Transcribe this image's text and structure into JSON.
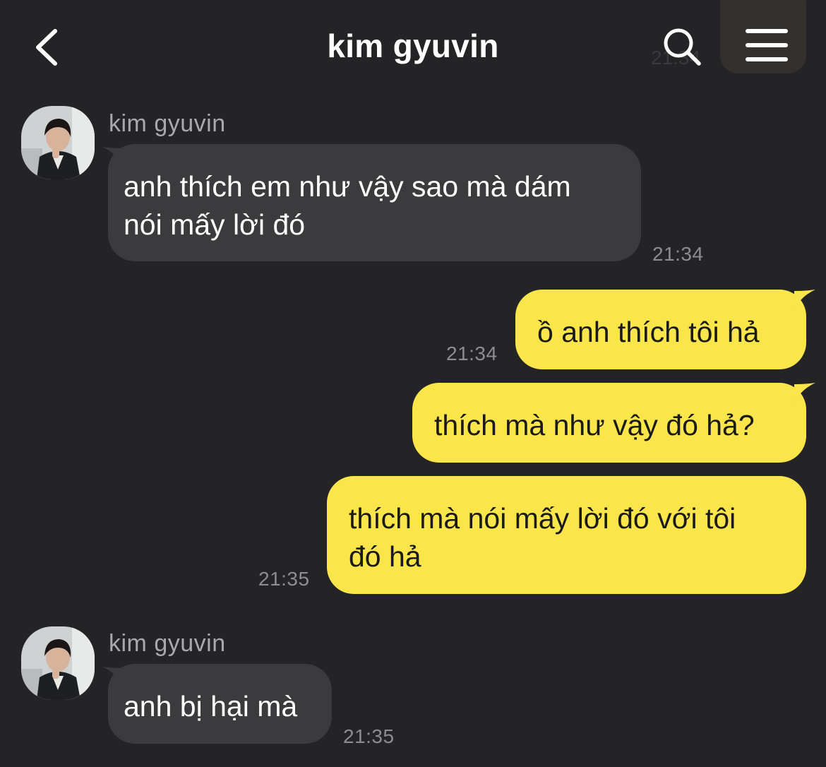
{
  "header": {
    "back_icon": "chevron-left-icon",
    "title": "kim gyuvin",
    "search_icon": "search-icon",
    "menu_icon": "hamburger-menu-icon",
    "obscured_time": "21:34"
  },
  "colors": {
    "background": "#242427",
    "incoming_bubble": "#3b3b3e",
    "outgoing_bubble": "#fae54a",
    "timestamp": "#8c8c91"
  },
  "messages": [
    {
      "direction": "incoming",
      "sender": "kim gyuvin",
      "lines": [
        "anh thích em như vậy sao mà dám",
        "nói mấy lời đó"
      ],
      "time": "21:34"
    },
    {
      "direction": "outgoing",
      "lines": [
        "ồ anh thích tôi hả"
      ],
      "time": "21:34"
    },
    {
      "direction": "outgoing",
      "lines": [
        "thích mà như vậy đó hả?"
      ],
      "time": ""
    },
    {
      "direction": "outgoing",
      "lines": [
        "thích mà nói mấy lời đó với tôi",
        "đó hả"
      ],
      "time": "21:35"
    },
    {
      "direction": "incoming",
      "sender": "kim gyuvin",
      "lines": [
        "anh bị hại mà"
      ],
      "time": "21:35"
    }
  ]
}
